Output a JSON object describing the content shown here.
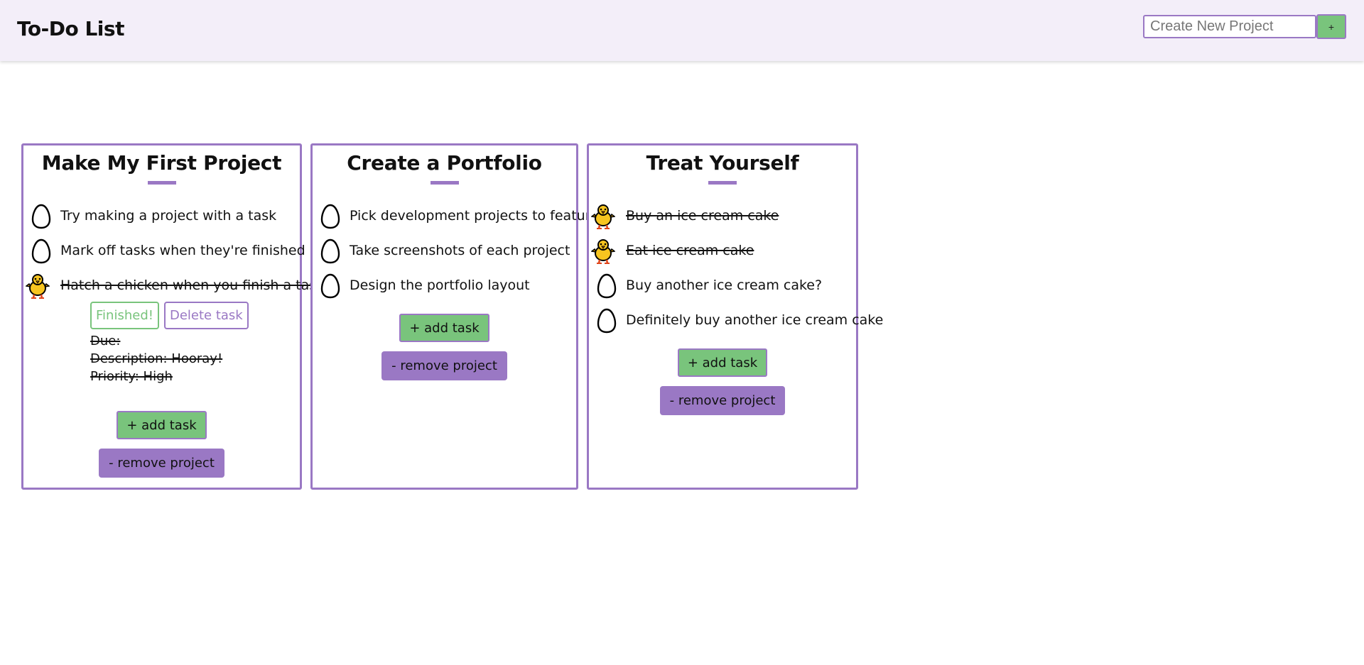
{
  "header": {
    "title": "To-Do List",
    "new_project_placeholder": "Create New Project",
    "add_button_label": "+"
  },
  "projects": [
    {
      "title": "Make My First Project",
      "tasks": [
        {
          "label": "Try making a project with a task",
          "state": "egg-icon"
        },
        {
          "label": "Mark off tasks when they're finished",
          "state": "egg-icon"
        },
        {
          "label": "Hatch a chicken when you finish a task!",
          "state": "chick-icon",
          "done": true
        }
      ],
      "expanded_task": {
        "finished_label": "Finished!",
        "delete_label": "Delete task",
        "due": "Due:",
        "description": "Description: Hooray!",
        "priority": "Priority: High"
      },
      "add_task_label": "+ add task",
      "remove_project_label": "- remove project"
    },
    {
      "title": "Create a Portfolio",
      "tasks": [
        {
          "label": "Pick development projects to feature",
          "state": "egg-icon"
        },
        {
          "label": "Take screenshots of each project",
          "state": "egg-icon"
        },
        {
          "label": "Design the portfolio layout",
          "state": "egg-icon"
        }
      ],
      "add_task_label": "+ add task",
      "remove_project_label": "- remove project"
    },
    {
      "title": "Treat Yourself",
      "tasks": [
        {
          "label": "Buy an ice cream cake",
          "state": "chick-icon",
          "done": true
        },
        {
          "label": "Eat ice cream cake",
          "state": "chick-icon",
          "done": true
        },
        {
          "label": "Buy another ice cream cake?",
          "state": "egg-icon"
        },
        {
          "label": "Definitely buy another ice cream cake",
          "state": "egg-icon"
        }
      ],
      "add_task_label": "+ add task",
      "remove_project_label": "- remove project"
    }
  ],
  "colors": {
    "accent_purple": "#9a78c4",
    "accent_green": "#79c47c",
    "header_bg": "#f3eef9"
  }
}
